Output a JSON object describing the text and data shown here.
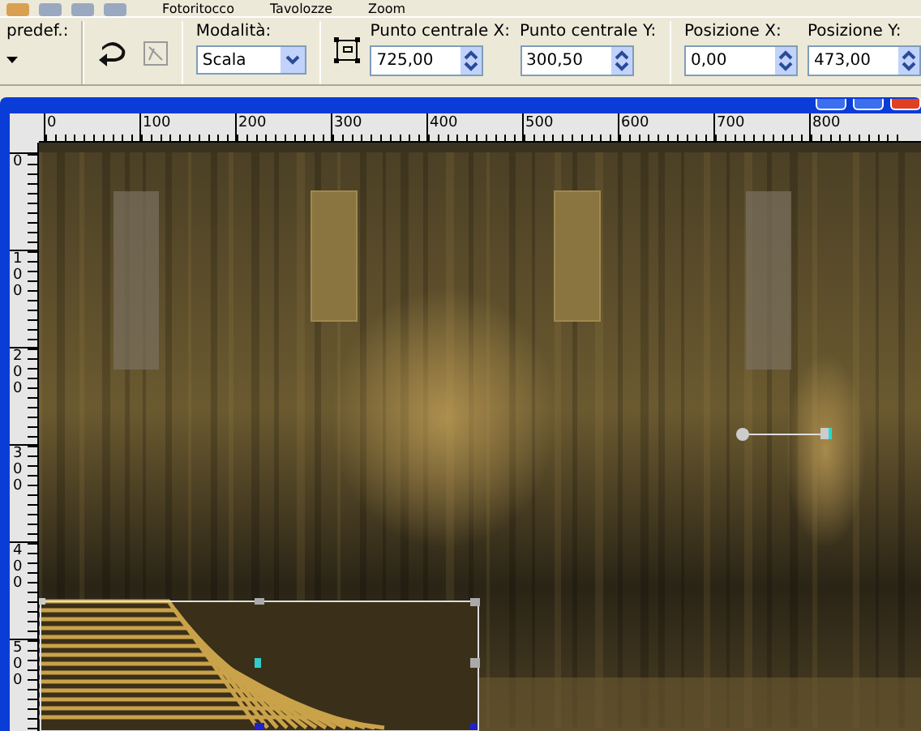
{
  "menu": [
    "Fotoritocco",
    "Tavolozze",
    "Zoom"
  ],
  "toolbar": {
    "preset": {
      "label": "predef.:"
    },
    "mode": {
      "label": "Modalità:",
      "value": "Scala"
    },
    "fields": [
      {
        "label": "Punto centrale X:",
        "value": "725,00"
      },
      {
        "label": "Punto centrale Y:",
        "value": "300,50"
      },
      {
        "label": "Posizione X:",
        "value": "0,00"
      },
      {
        "label": "Posizione Y:",
        "value": "473,00"
      }
    ]
  },
  "rulers": {
    "horizontal": [
      "0",
      "100",
      "200",
      "300",
      "400",
      "500",
      "600",
      "700",
      "800"
    ],
    "vertical": [
      "0",
      "100",
      "200",
      "300",
      "400",
      "500"
    ]
  }
}
